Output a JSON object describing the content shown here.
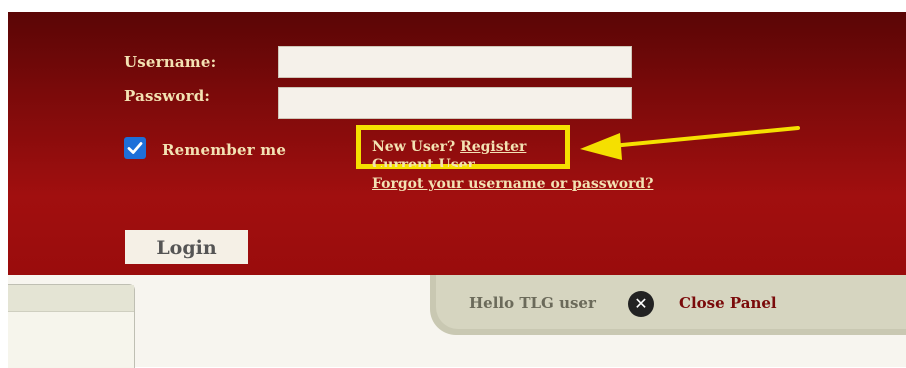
{
  "login": {
    "username_label": "Username:",
    "password_label": "Password:",
    "username_value": "",
    "password_value": "",
    "remember_label": "Remember me",
    "remember_checked": true,
    "new_user_text": "New User?",
    "register_link": "Register",
    "current_users_link": "Current User",
    "forgot_link": "Forgot your username or password?",
    "login_button": "Login"
  },
  "panel_tab": {
    "greeting": "Hello TLG user",
    "close_icon_glyph": "✕",
    "close_label": "Close Panel"
  },
  "colors": {
    "panel_dark": "#5a0505",
    "panel_red": "#a10f0f",
    "label_gold": "#f3e2b3",
    "highlight_yellow": "#f5e000",
    "checkbox_blue": "#1e6fd9"
  }
}
